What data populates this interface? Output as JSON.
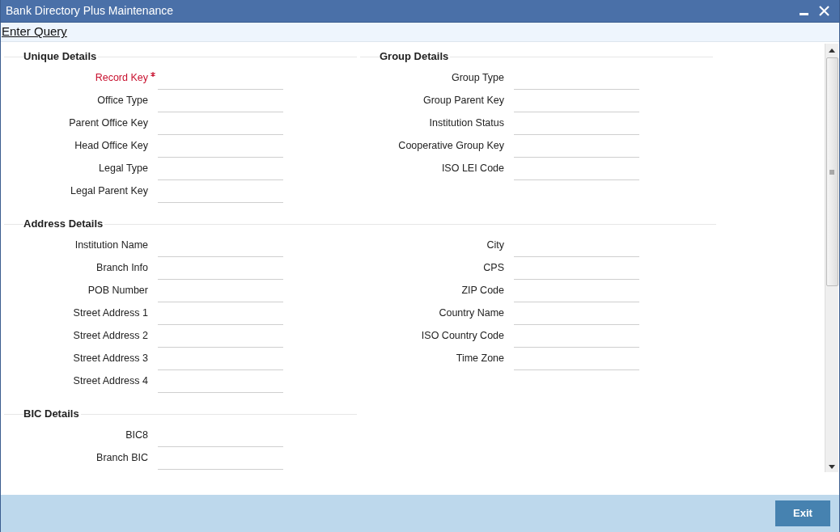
{
  "window": {
    "title": "Bank Directory Plus Maintenance"
  },
  "toolbar": {
    "link": "Enter Query"
  },
  "sections": [
    {
      "panels": [
        {
          "title": "Unique Details",
          "columns": [
            [
              {
                "label": "Record Key",
                "required": true
              },
              {
                "label": "Office Type",
                "required": false
              },
              {
                "label": "Parent Office Key",
                "required": false
              },
              {
                "label": "Head Office Key",
                "required": false
              },
              {
                "label": "Legal Type",
                "required": false
              },
              {
                "label": "Legal Parent Key",
                "required": false
              }
            ]
          ]
        },
        {
          "title": "Group Details",
          "columns": [
            [
              {
                "label": "Group Type",
                "required": false
              },
              {
                "label": "Group Parent Key",
                "required": false
              },
              {
                "label": "Institution Status",
                "required": false
              },
              {
                "label": "Cooperative Group Key",
                "required": false
              },
              {
                "label": "ISO LEI Code",
                "required": false
              }
            ]
          ]
        }
      ]
    },
    {
      "panels": [
        {
          "title": "Address Details",
          "columns": [
            [
              {
                "label": "Institution Name",
                "required": false
              },
              {
                "label": "Branch Info",
                "required": false
              },
              {
                "label": "POB Number",
                "required": false
              },
              {
                "label": "Street Address 1",
                "required": false
              },
              {
                "label": "Street Address 2",
                "required": false
              },
              {
                "label": "Street Address 3",
                "required": false
              },
              {
                "label": "Street Address 4",
                "required": false
              }
            ],
            [
              {
                "label": "City",
                "required": false
              },
              {
                "label": "CPS",
                "required": false
              },
              {
                "label": "ZIP Code",
                "required": false
              },
              {
                "label": "Country Name",
                "required": false
              },
              {
                "label": "ISO Country Code",
                "required": false
              },
              {
                "label": "Time Zone",
                "required": false
              }
            ]
          ]
        }
      ]
    },
    {
      "panels": [
        {
          "title": "BIC Details",
          "columns": [
            [
              {
                "label": "BIC8",
                "required": false
              },
              {
                "label": "Branch BIC",
                "required": false
              }
            ]
          ]
        }
      ]
    }
  ],
  "footer": {
    "buttons": [
      "Exit"
    ]
  }
}
